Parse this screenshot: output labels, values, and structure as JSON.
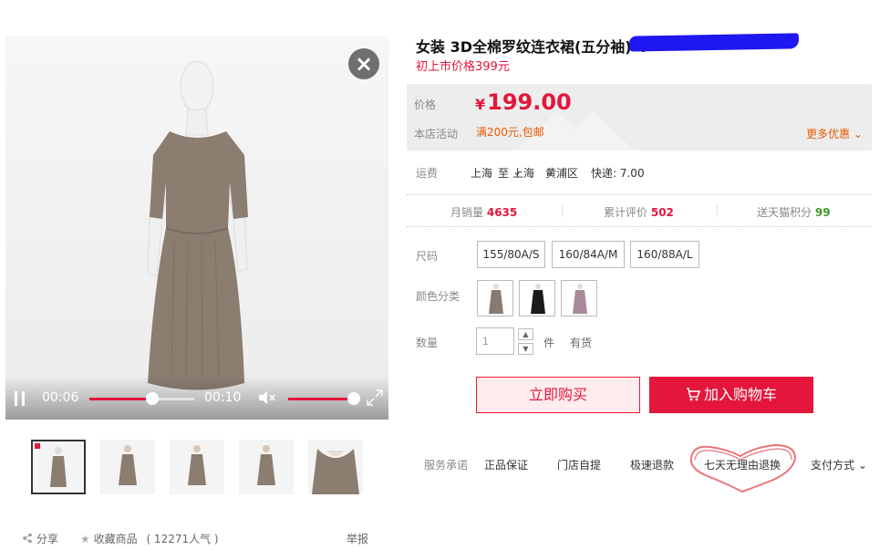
{
  "video": {
    "current_time": "00:06",
    "duration": "00:10",
    "progress": 0.6,
    "volume": 1.0
  },
  "thumbnails": [
    {
      "label": "thumb-1",
      "active": true
    },
    {
      "label": "thumb-2",
      "active": false
    },
    {
      "label": "thumb-3",
      "active": false
    },
    {
      "label": "thumb-4",
      "active": false
    },
    {
      "label": "thumb-5",
      "active": false
    }
  ],
  "share_bar": {
    "share_label": "分享",
    "favorite_label": "收藏商品",
    "popularity": "( 12271人气 )",
    "report_label": "举报"
  },
  "product": {
    "title": "女装 3D全棉罗纹连衣裙(五分袖) 4",
    "subtitle": "初上市价格399元"
  },
  "price": {
    "label": "价格",
    "currency": "¥",
    "value": "199.00",
    "promo_label": "本店活动",
    "promo_value": "满200元,包邮",
    "more_deals": "更多优惠"
  },
  "shipping": {
    "label": "运费",
    "from": "上海",
    "to_word": "至",
    "to_city": "上海",
    "to_district": "黄浦区",
    "express": "快递: 7.00"
  },
  "stats": {
    "monthly_sales_label": "月销量",
    "monthly_sales": "4635",
    "reviews_label": "累计评价",
    "reviews": "502",
    "points_label": "送天猫积分",
    "points": "99"
  },
  "options": {
    "size_label": "尺码",
    "sizes": [
      "155/80A/S",
      "160/84A/M",
      "160/88A/L"
    ],
    "color_label": "颜色分类",
    "colors": [
      "#8a7a6e",
      "#1a1a1a",
      "#a88a9a"
    ],
    "quantity_label": "数量",
    "quantity": "1",
    "unit": "件",
    "stock": "有货"
  },
  "actions": {
    "buy_now": "立即购买",
    "add_to_cart": "加入购物车"
  },
  "services": {
    "label": "服务承诺",
    "items": [
      "正品保证",
      "门店自提",
      "极速退款",
      "七天无理由退换"
    ],
    "payment": "支付方式"
  },
  "colors": {
    "accent": "#e4163b",
    "promo": "#e85b00",
    "points": "#3a9a23"
  }
}
